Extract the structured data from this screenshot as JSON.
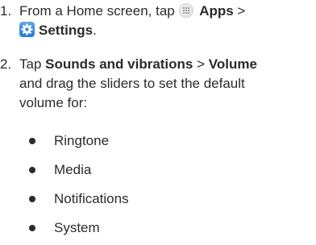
{
  "steps": [
    {
      "number": "1.",
      "text_before_apps": "From a Home screen, tap ",
      "apps_label": "Apps",
      "separator": " >",
      "settings_label": "Settings",
      "ending": ".",
      "icons": [
        "apps-icon",
        "settings-icon"
      ]
    },
    {
      "number": "2.",
      "tap_word": "Tap ",
      "sounds_label": "Sounds and vibrations",
      "separator": " > ",
      "volume_label": "Volume",
      "line2": "and drag the sliders to set the default",
      "line3": "volume for:"
    }
  ],
  "volume_options": [
    "Ringtone",
    "Media",
    "Notifications",
    "System"
  ]
}
